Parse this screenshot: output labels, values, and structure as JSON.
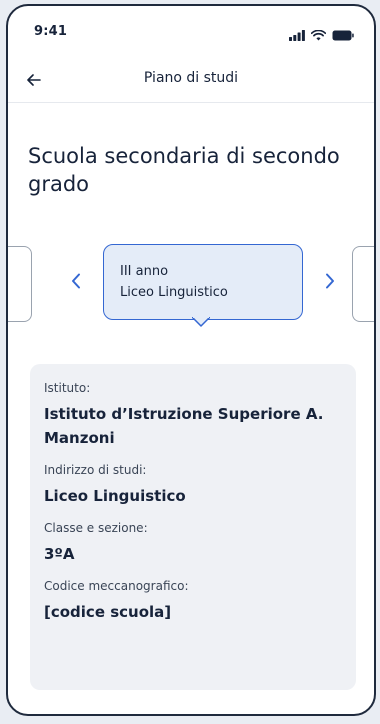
{
  "status_bar": {
    "time": "9:41",
    "icons": [
      "signal-icon",
      "wifi-icon",
      "battery-icon"
    ]
  },
  "header": {
    "back_icon": "arrow-left-icon",
    "title": "Piano di studi"
  },
  "page": {
    "title": "Scuola secondaria di secondo grado"
  },
  "carousel": {
    "selected": {
      "line1": "III anno",
      "line2": "Liceo Linguistico"
    },
    "prev_icon": "chevron-left-icon",
    "next_icon": "chevron-right-icon"
  },
  "details": {
    "istituto": {
      "label": "Istituto:",
      "value": "Istituto d’Istruzione Superiore A. Manzoni"
    },
    "indirizzo": {
      "label": "Indirizzo di studi:",
      "value": "Liceo Linguistico"
    },
    "classe": {
      "label": "Classe e sezione:",
      "value": "3ºA"
    },
    "codice": {
      "label": "Codice meccanografico:",
      "value": "[codice scuola]"
    }
  },
  "colors": {
    "accent": "#3467d2",
    "card_bg": "#e4ecf8",
    "panel_bg": "#eff1f5",
    "text": "#17233a"
  }
}
